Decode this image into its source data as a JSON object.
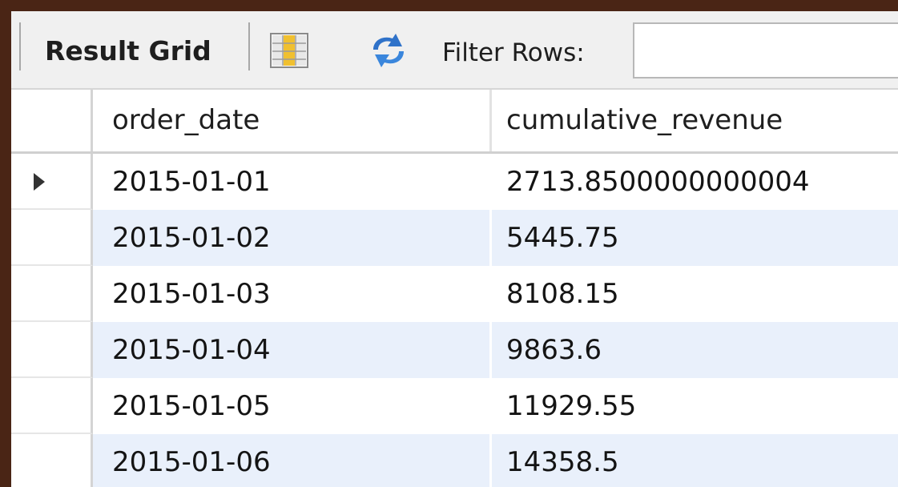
{
  "toolbar": {
    "result_grid_label": "Result Grid",
    "filter_label": "Filter Rows:",
    "filter_value": "",
    "icons": [
      "grid-layout-icon",
      "refresh-icon"
    ]
  },
  "table": {
    "columns": [
      "order_date",
      "cumulative_revenue"
    ],
    "rows": [
      {
        "order_date": "2015-01-01",
        "cumulative_revenue": "2713.8500000000004"
      },
      {
        "order_date": "2015-01-02",
        "cumulative_revenue": "5445.75"
      },
      {
        "order_date": "2015-01-03",
        "cumulative_revenue": "8108.15"
      },
      {
        "order_date": "2015-01-04",
        "cumulative_revenue": "9863.6"
      },
      {
        "order_date": "2015-01-05",
        "cumulative_revenue": "11929.55"
      },
      {
        "order_date": "2015-01-06",
        "cumulative_revenue": "14358.5"
      }
    ]
  },
  "colors": {
    "background": "#4a2515",
    "alt_row": "#e9f0fb",
    "refresh_blue": "#2f72c9"
  }
}
